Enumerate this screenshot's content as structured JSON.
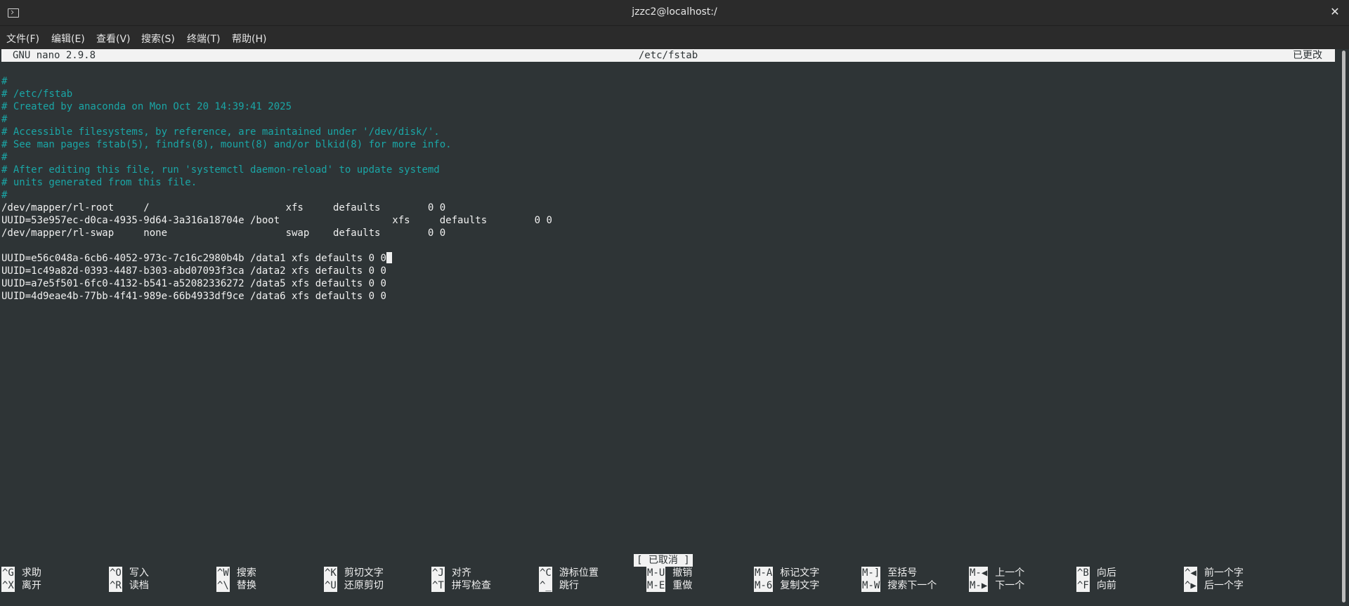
{
  "window": {
    "title": "jzzc2@localhost:/",
    "close_glyph": "✕"
  },
  "menu": [
    "文件(F)",
    "编辑(E)",
    "查看(V)",
    "搜索(S)",
    "终端(T)",
    "帮助(H)"
  ],
  "nano": {
    "version": "GNU nano 2.9.8",
    "file": "/etc/fstab",
    "modified": "已更改"
  },
  "file_lines": [
    {
      "text": "",
      "comment": false
    },
    {
      "text": "#",
      "comment": true
    },
    {
      "text": "# /etc/fstab",
      "comment": true
    },
    {
      "text": "# Created by anaconda on Mon Oct 20 14:39:41 2025",
      "comment": true
    },
    {
      "text": "#",
      "comment": true
    },
    {
      "text": "# Accessible filesystems, by reference, are maintained under '/dev/disk/'.",
      "comment": true
    },
    {
      "text": "# See man pages fstab(5), findfs(8), mount(8) and/or blkid(8) for more info.",
      "comment": true
    },
    {
      "text": "#",
      "comment": true
    },
    {
      "text": "# After editing this file, run 'systemctl daemon-reload' to update systemd",
      "comment": true
    },
    {
      "text": "# units generated from this file.",
      "comment": true
    },
    {
      "text": "#",
      "comment": true
    },
    {
      "text": "/dev/mapper/rl-root     /                       xfs     defaults        0 0",
      "comment": false
    },
    {
      "text": "UUID=53e957ec-d0ca-4935-9d64-3a316a18704e /boot                   xfs     defaults        0 0",
      "comment": false
    },
    {
      "text": "/dev/mapper/rl-swap     none                    swap    defaults        0 0",
      "comment": false
    },
    {
      "text": "",
      "comment": false
    },
    {
      "text": "UUID=e56c048a-6cb6-4052-973c-7c16c2980b4b /data1 xfs defaults 0 0",
      "comment": false,
      "cursor": true
    },
    {
      "text": "UUID=1c49a82d-0393-4487-b303-abd07093f3ca /data2 xfs defaults 0 0",
      "comment": false
    },
    {
      "text": "UUID=a7e5f501-6fc0-4132-b541-a52082336272 /data5 xfs defaults 0 0",
      "comment": false
    },
    {
      "text": "UUID=4d9eae4b-77bb-4f41-989e-66b4933df9ce /data6 xfs defaults 0 0",
      "comment": false
    }
  ],
  "status_message": "[ 已取消 ]",
  "shortcuts": [
    [
      {
        "key": "^G",
        "desc": "求助"
      },
      {
        "key": "^X",
        "desc": "离开"
      }
    ],
    [
      {
        "key": "^O",
        "desc": "写入"
      },
      {
        "key": "^R",
        "desc": "读档"
      }
    ],
    [
      {
        "key": "^W",
        "desc": "搜索"
      },
      {
        "key": "^\\",
        "desc": "替换"
      }
    ],
    [
      {
        "key": "^K",
        "desc": "剪切文字"
      },
      {
        "key": "^U",
        "desc": "还原剪切"
      }
    ],
    [
      {
        "key": "^J",
        "desc": "对齐"
      },
      {
        "key": "^T",
        "desc": "拼写检查"
      }
    ],
    [
      {
        "key": "^C",
        "desc": "游标位置"
      },
      {
        "key": "^_",
        "desc": "跳行"
      }
    ],
    [
      {
        "key": "M-U",
        "desc": "撤销"
      },
      {
        "key": "M-E",
        "desc": "重做"
      }
    ],
    [
      {
        "key": "M-A",
        "desc": "标记文字"
      },
      {
        "key": "M-6",
        "desc": "复制文字"
      }
    ],
    [
      {
        "key": "M-]",
        "desc": "至括号"
      },
      {
        "key": "M-W",
        "desc": "搜索下一个"
      }
    ],
    [
      {
        "key": "M-◀",
        "desc": "上一个"
      },
      {
        "key": "M-▶",
        "desc": "下一个"
      }
    ],
    [
      {
        "key": "^B",
        "desc": "向后"
      },
      {
        "key": "^F",
        "desc": "向前"
      }
    ],
    [
      {
        "key": "^◀",
        "desc": "前一个字"
      },
      {
        "key": "^▶",
        "desc": "后一个字"
      }
    ]
  ]
}
